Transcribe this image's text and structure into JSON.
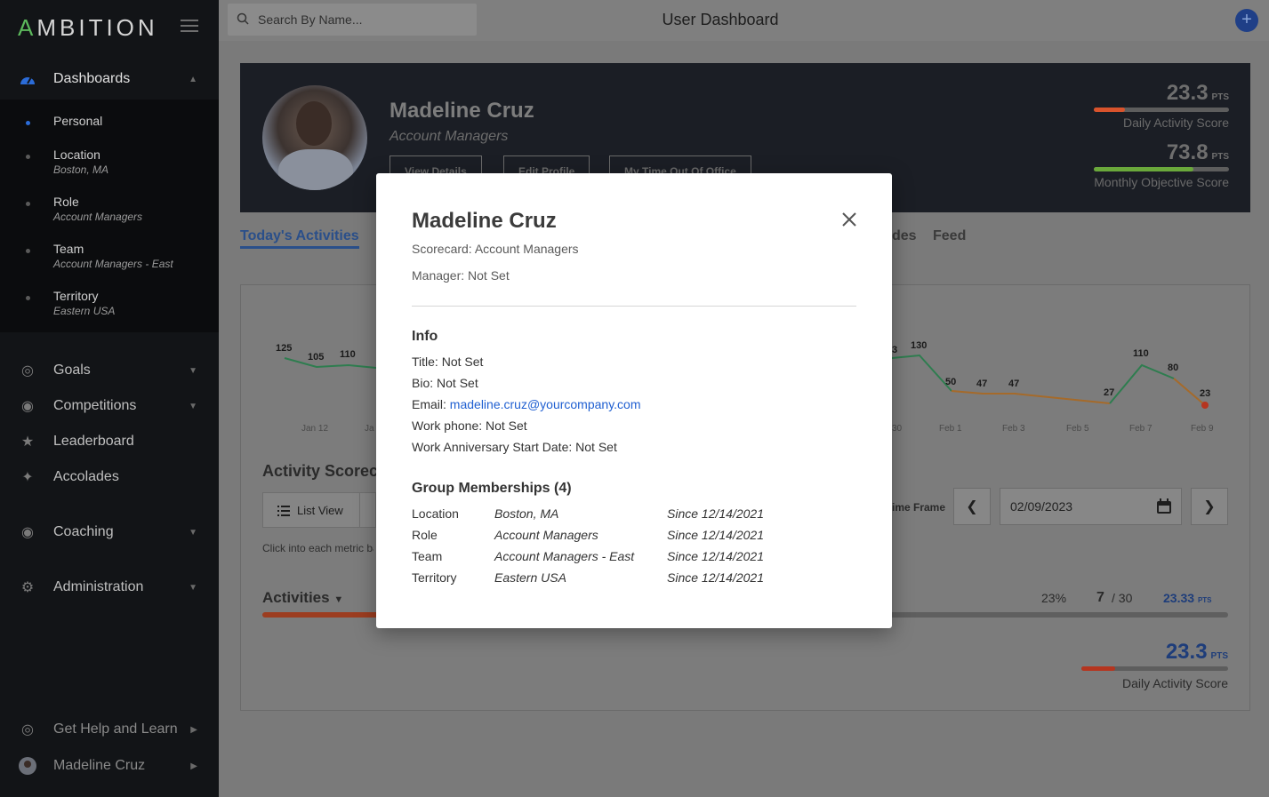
{
  "sidebar": {
    "logo": {
      "a": "A",
      "rest": "MBITION"
    },
    "nav": [
      {
        "label": "Dashboards",
        "icon": "gauge-icon"
      },
      {
        "label": "Goals",
        "icon": "target-icon"
      },
      {
        "label": "Competitions",
        "icon": "helmet-icon"
      },
      {
        "label": "Leaderboard",
        "icon": "trophy-icon"
      },
      {
        "label": "Accolades",
        "icon": "medal-icon"
      },
      {
        "label": "Coaching",
        "icon": "whistle-icon"
      },
      {
        "label": "Administration",
        "icon": "gears-icon"
      },
      {
        "label": "Get Help and Learn",
        "icon": "lifebuoy-icon"
      },
      {
        "label": "Madeline Cruz",
        "icon": "avatar-icon"
      }
    ],
    "sub": [
      {
        "title": "Personal",
        "subtitle": ""
      },
      {
        "title": "Location",
        "subtitle": "Boston, MA"
      },
      {
        "title": "Role",
        "subtitle": "Account Managers"
      },
      {
        "title": "Team",
        "subtitle": "Account Managers - East"
      },
      {
        "title": "Territory",
        "subtitle": "Eastern USA"
      }
    ]
  },
  "header": {
    "search_placeholder": "Search By Name...",
    "title": "User Dashboard",
    "add": "+"
  },
  "banner": {
    "name": "Madeline Cruz",
    "role": "Account Managers",
    "buttons": [
      "View Details",
      "Edit Profile",
      "My Time Out Of Office"
    ],
    "scores": [
      {
        "value": "23.3",
        "unit": "PTS",
        "label": "Daily Activity Score",
        "fill": 0.233,
        "color": "#d9532c"
      },
      {
        "value": "73.8",
        "unit": "PTS",
        "label": "Monthly Objective Score",
        "fill": 0.738,
        "color": "#6aa83b"
      }
    ]
  },
  "tabs": [
    {
      "label": "Today's Activities"
    },
    {
      "label": "des"
    },
    {
      "label": "Feed"
    }
  ],
  "chart": {
    "left_labels": [
      "125",
      "105",
      "110"
    ],
    "right_labels": [
      "3",
      "130",
      "50",
      "47",
      "47",
      "27",
      "110",
      "80",
      "23"
    ],
    "ticks_left": [
      "Jan 12",
      "Ja"
    ],
    "ticks_right": [
      "30",
      "Feb 1",
      "Feb 3",
      "Feb 5",
      "Feb 7",
      "Feb 9"
    ]
  },
  "scorecard": {
    "title": "Activity Scoreca",
    "list_view": "List View",
    "hint": "Click into each metric ba",
    "activities": "Activities",
    "timeframe": "ime Frame",
    "date": "02/09/2023",
    "percent": "23%",
    "count": "7",
    "count_total": "/ 30",
    "pts": "23.33",
    "pts_unit": "PTS",
    "bottom_value": "23.3",
    "bottom_unit": "PTS",
    "bottom_label": "Daily Activity Score"
  },
  "modal": {
    "name": "Madeline Cruz",
    "scorecard": "Scorecard: Account Managers",
    "manager": "Manager: Not Set",
    "info_title": "Info",
    "title_line": "Title: Not Set",
    "bio_line": "Bio: Not Set",
    "email_label": "Email: ",
    "email": "madeline.cruz@yourcompany.com",
    "phone_line": "Work phone: Not Set",
    "anniversary_line": "Work Anniversary Start Date: Not Set",
    "groups_title": "Group Memberships (4)",
    "groups": [
      {
        "type": "Location",
        "name": "Boston, MA",
        "since": "Since 12/14/2021"
      },
      {
        "type": "Role",
        "name": "Account Managers",
        "since": "Since 12/14/2021"
      },
      {
        "type": "Team",
        "name": "Account Managers - East",
        "since": "Since 12/14/2021"
      },
      {
        "type": "Territory",
        "name": "Eastern USA",
        "since": "Since 12/14/2021"
      }
    ]
  }
}
